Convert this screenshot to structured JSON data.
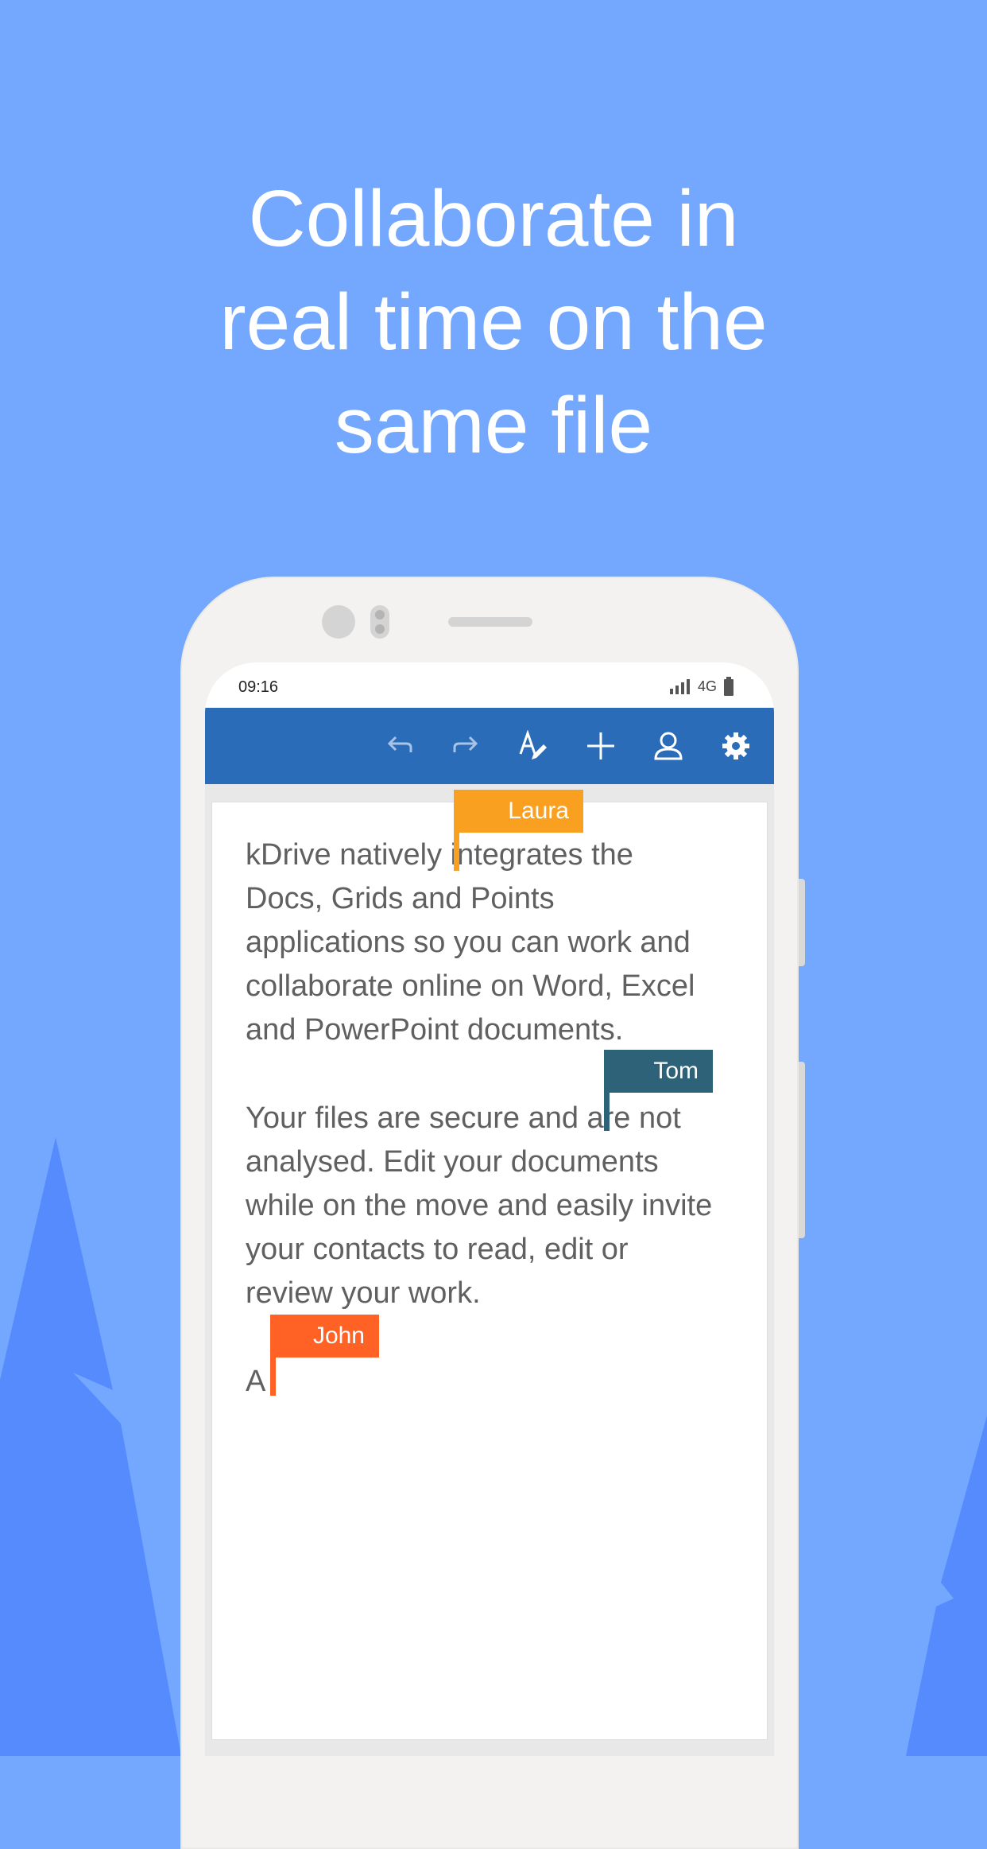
{
  "headline": {
    "line1": "Collaborate in",
    "line2": "real time on the",
    "line3": "same file"
  },
  "status_bar": {
    "time": "09:16",
    "network": "4G"
  },
  "toolbar": {
    "icons": [
      "undo-icon",
      "redo-icon",
      "text-format-icon",
      "add-icon",
      "user-icon",
      "settings-icon"
    ],
    "color": "#2b6cb9"
  },
  "document": {
    "paragraph1": [
      "kDrive natively integrates the",
      "Docs, Grids and Points",
      "applications so you can work and",
      "collaborate online on Word, Excel",
      "and PowerPoint documents."
    ],
    "paragraph2": [
      "Your files are secure and are not",
      "analysed. Edit your documents",
      "while on the move and easily invite",
      "your contacts to read, edit or",
      "review your work."
    ],
    "paragraph3": "A"
  },
  "collaborators": [
    {
      "name": "Laura",
      "color": "#f9a021"
    },
    {
      "name": "Tom",
      "color": "#2d6278"
    },
    {
      "name": "John",
      "color": "#ff6224"
    }
  ]
}
